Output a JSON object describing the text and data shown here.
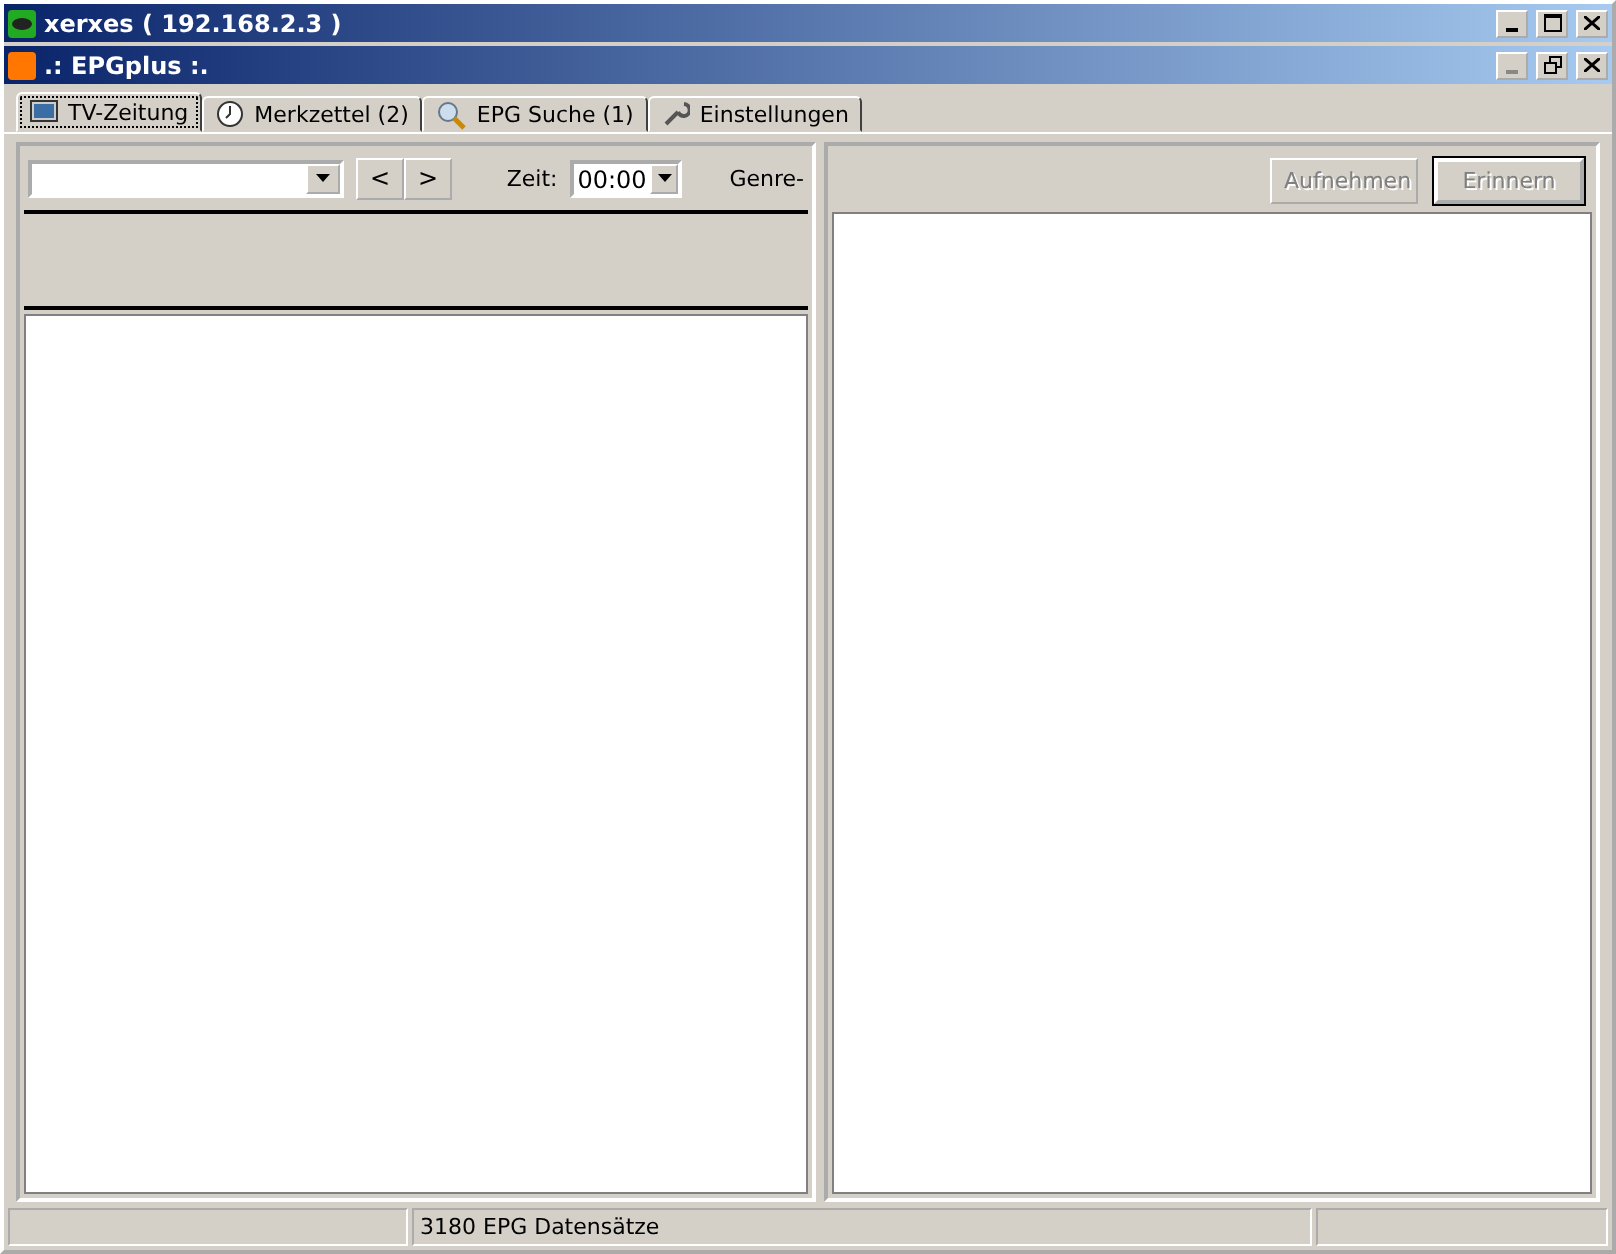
{
  "window": {
    "title": "xerxes ( 192.168.2.3 )"
  },
  "child_window": {
    "title": ".: EPGplus :."
  },
  "tabs": [
    {
      "label": "TV-Zeitung",
      "selected": true,
      "kind": "tv"
    },
    {
      "label": "Merkzettel (2)",
      "selected": false,
      "kind": "clock"
    },
    {
      "label": "EPG Suche (1)",
      "selected": false,
      "kind": "search"
    },
    {
      "label": "Einstellungen",
      "selected": false,
      "kind": "wrench"
    }
  ],
  "toolbar": {
    "prev": "<",
    "next": ">",
    "time_label": "Zeit:",
    "time_value": "00:00",
    "genre_label": "Genre-"
  },
  "buttons": [
    {
      "label": "Aufnehmen",
      "disabled": true,
      "default": false
    },
    {
      "label": "Erinnern",
      "disabled": true,
      "default": true
    }
  ],
  "status_bar": {
    "text": "3180 EPG Datensätze"
  }
}
